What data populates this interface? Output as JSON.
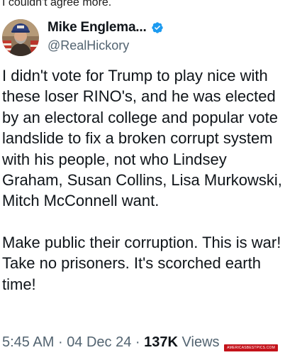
{
  "caption": "I couldn't agree more.",
  "tweet": {
    "author": {
      "display_name": "Mike Englema...",
      "handle": "@RealHickory",
      "verified": true
    },
    "text_paragraphs": [
      "I didn't vote for Trump to play nice with these loser RINO's, and he was elected by an electoral college and popular vote landslide to fix a broken corrupt system with his people, not who Lindsey Graham, Susan Collins, Lisa Murkowski, Mitch McConnell want.",
      "Make public their corruption. This is war! Take no prisoners. It's scorched earth time!"
    ],
    "meta": {
      "time": "5:45 AM",
      "separator": "·",
      "date": "04 Dec 24",
      "views_count": "137K",
      "views_label": "Views"
    }
  },
  "watermark": "AMERICASBESTPICS.COM",
  "colors": {
    "text": "#0f1419",
    "secondary": "#536471",
    "verified": "#1d9bf0",
    "watermark_bg": "#c4121a"
  },
  "icons": {
    "verified": "verified-badge-icon",
    "avatar": "profile-avatar"
  }
}
